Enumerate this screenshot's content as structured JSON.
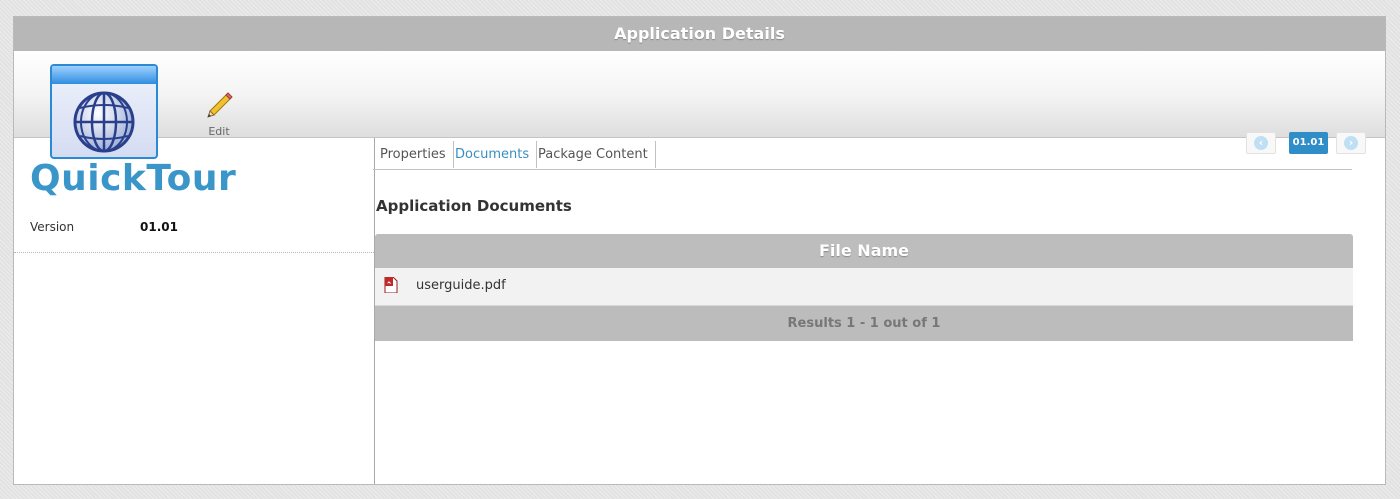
{
  "header": {
    "title": "Application Details"
  },
  "toolbar": {
    "app_icon": "globe-window-icon",
    "edit_icon": "pencil-icon",
    "edit_label": "Edit"
  },
  "app": {
    "name": "QuickTour",
    "version_label": "Version",
    "version_value": "01.01"
  },
  "tabs": [
    {
      "label": "Properties",
      "active": false
    },
    {
      "label": "Documents",
      "active": true
    },
    {
      "label": "Package Content",
      "active": false
    }
  ],
  "pager": {
    "prev_icon": "arrow-left-icon",
    "current": "01.01",
    "next_icon": "arrow-right-icon"
  },
  "documents": {
    "title": "Application Documents",
    "column_header": "File Name",
    "rows": [
      {
        "icon": "pdf-icon",
        "file_name": "userguide.pdf"
      }
    ],
    "footer": "Results 1 - 1 out of 1"
  },
  "colors": {
    "accent": "#3a96c8",
    "header_bg": "#b7b7b7",
    "pager_active": "#2f8dc8"
  }
}
